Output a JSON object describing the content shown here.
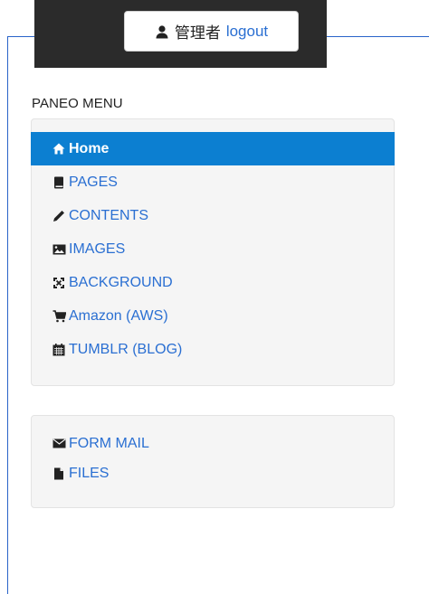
{
  "header": {
    "user_name": "管理者",
    "logout_label": "logout"
  },
  "menu": {
    "title": "PANEO MENU",
    "main_items": [
      {
        "label": "Home",
        "icon": "home-icon",
        "active": true
      },
      {
        "label": "PAGES",
        "icon": "book-icon"
      },
      {
        "label": "CONTENTS",
        "icon": "pencil-icon"
      },
      {
        "label": "IMAGES",
        "icon": "picture-icon"
      },
      {
        "label": "BACKGROUND",
        "icon": "fullscreen-icon"
      },
      {
        "label": "Amazon (AWS)",
        "icon": "shopping-cart-icon"
      },
      {
        "label": "TUMBLR (BLOG)",
        "icon": "calendar-icon"
      }
    ],
    "secondary_items": [
      {
        "label": "FORM MAIL",
        "icon": "envelope-icon"
      },
      {
        "label": "FILES",
        "icon": "file-icon"
      }
    ]
  },
  "colors": {
    "accent": "#0c7fd1",
    "link": "#2a6fd2",
    "topbar": "#2b2b2b",
    "frame": "#2a64c9"
  }
}
